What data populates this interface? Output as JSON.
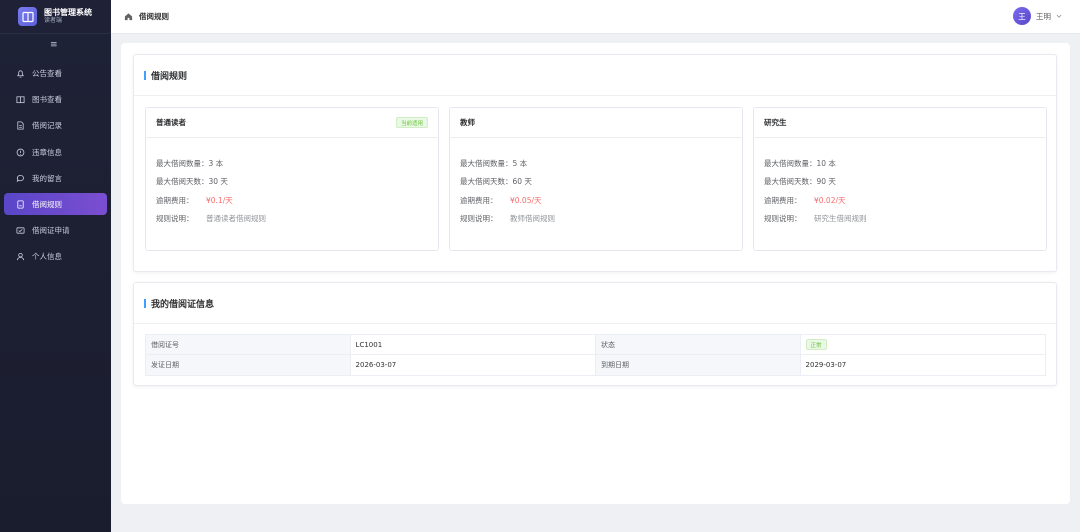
{
  "app": {
    "title": "图书管理系统",
    "subtitle": "读者端"
  },
  "sidebar": {
    "items": [
      {
        "label": "公告查看",
        "icon": "bell-icon"
      },
      {
        "label": "图书查看",
        "icon": "book-icon"
      },
      {
        "label": "借阅记录",
        "icon": "document-icon"
      },
      {
        "label": "违章信息",
        "icon": "warning-icon"
      },
      {
        "label": "我的留言",
        "icon": "chat-icon"
      },
      {
        "label": "借阅规则",
        "icon": "rule-icon",
        "active": true
      },
      {
        "label": "借阅证申请",
        "icon": "card-icon"
      },
      {
        "label": "个人信息",
        "icon": "user-icon"
      }
    ]
  },
  "header": {
    "breadcrumb": "借阅规则",
    "user_name": "王明",
    "avatar_initial": "王"
  },
  "rules_section": {
    "title": "借阅规则",
    "rules": [
      {
        "name": "普通读者",
        "badge": "当前适用",
        "max_count": "最大借阅数量：3 本",
        "max_days": "最大借阅天数：30 天",
        "fee_label": "逾期费用：",
        "fee": "¥0.1/天",
        "desc_label": "规则说明：",
        "desc": "普通读者借阅规则"
      },
      {
        "name": "教师",
        "badge": "",
        "max_count": "最大借阅数量：5 本",
        "max_days": "最大借阅天数：60 天",
        "fee_label": "逾期费用：",
        "fee": "¥0.05/天",
        "desc_label": "规则说明：",
        "desc": "教师借阅规则"
      },
      {
        "name": "研究生",
        "badge": "",
        "max_count": "最大借阅数量：10 本",
        "max_days": "最大借阅天数：90 天",
        "fee_label": "逾期费用：",
        "fee": "¥0.02/天",
        "desc_label": "规则说明：",
        "desc": "研究生借阅规则"
      }
    ]
  },
  "card_section": {
    "title": "我的借阅证信息",
    "rows": [
      {
        "l1": "借阅证号",
        "v1": "LC1001",
        "l2": "状态",
        "v2": "正常"
      },
      {
        "l1": "发证日期",
        "v1": "2026-03-07",
        "l2": "到期日期",
        "v2": "2029-03-07"
      }
    ]
  },
  "colors": {
    "accent": "#409eff",
    "active_menu": "#6a4acd",
    "fee": "#f56c6c",
    "success": "#67c23a"
  }
}
